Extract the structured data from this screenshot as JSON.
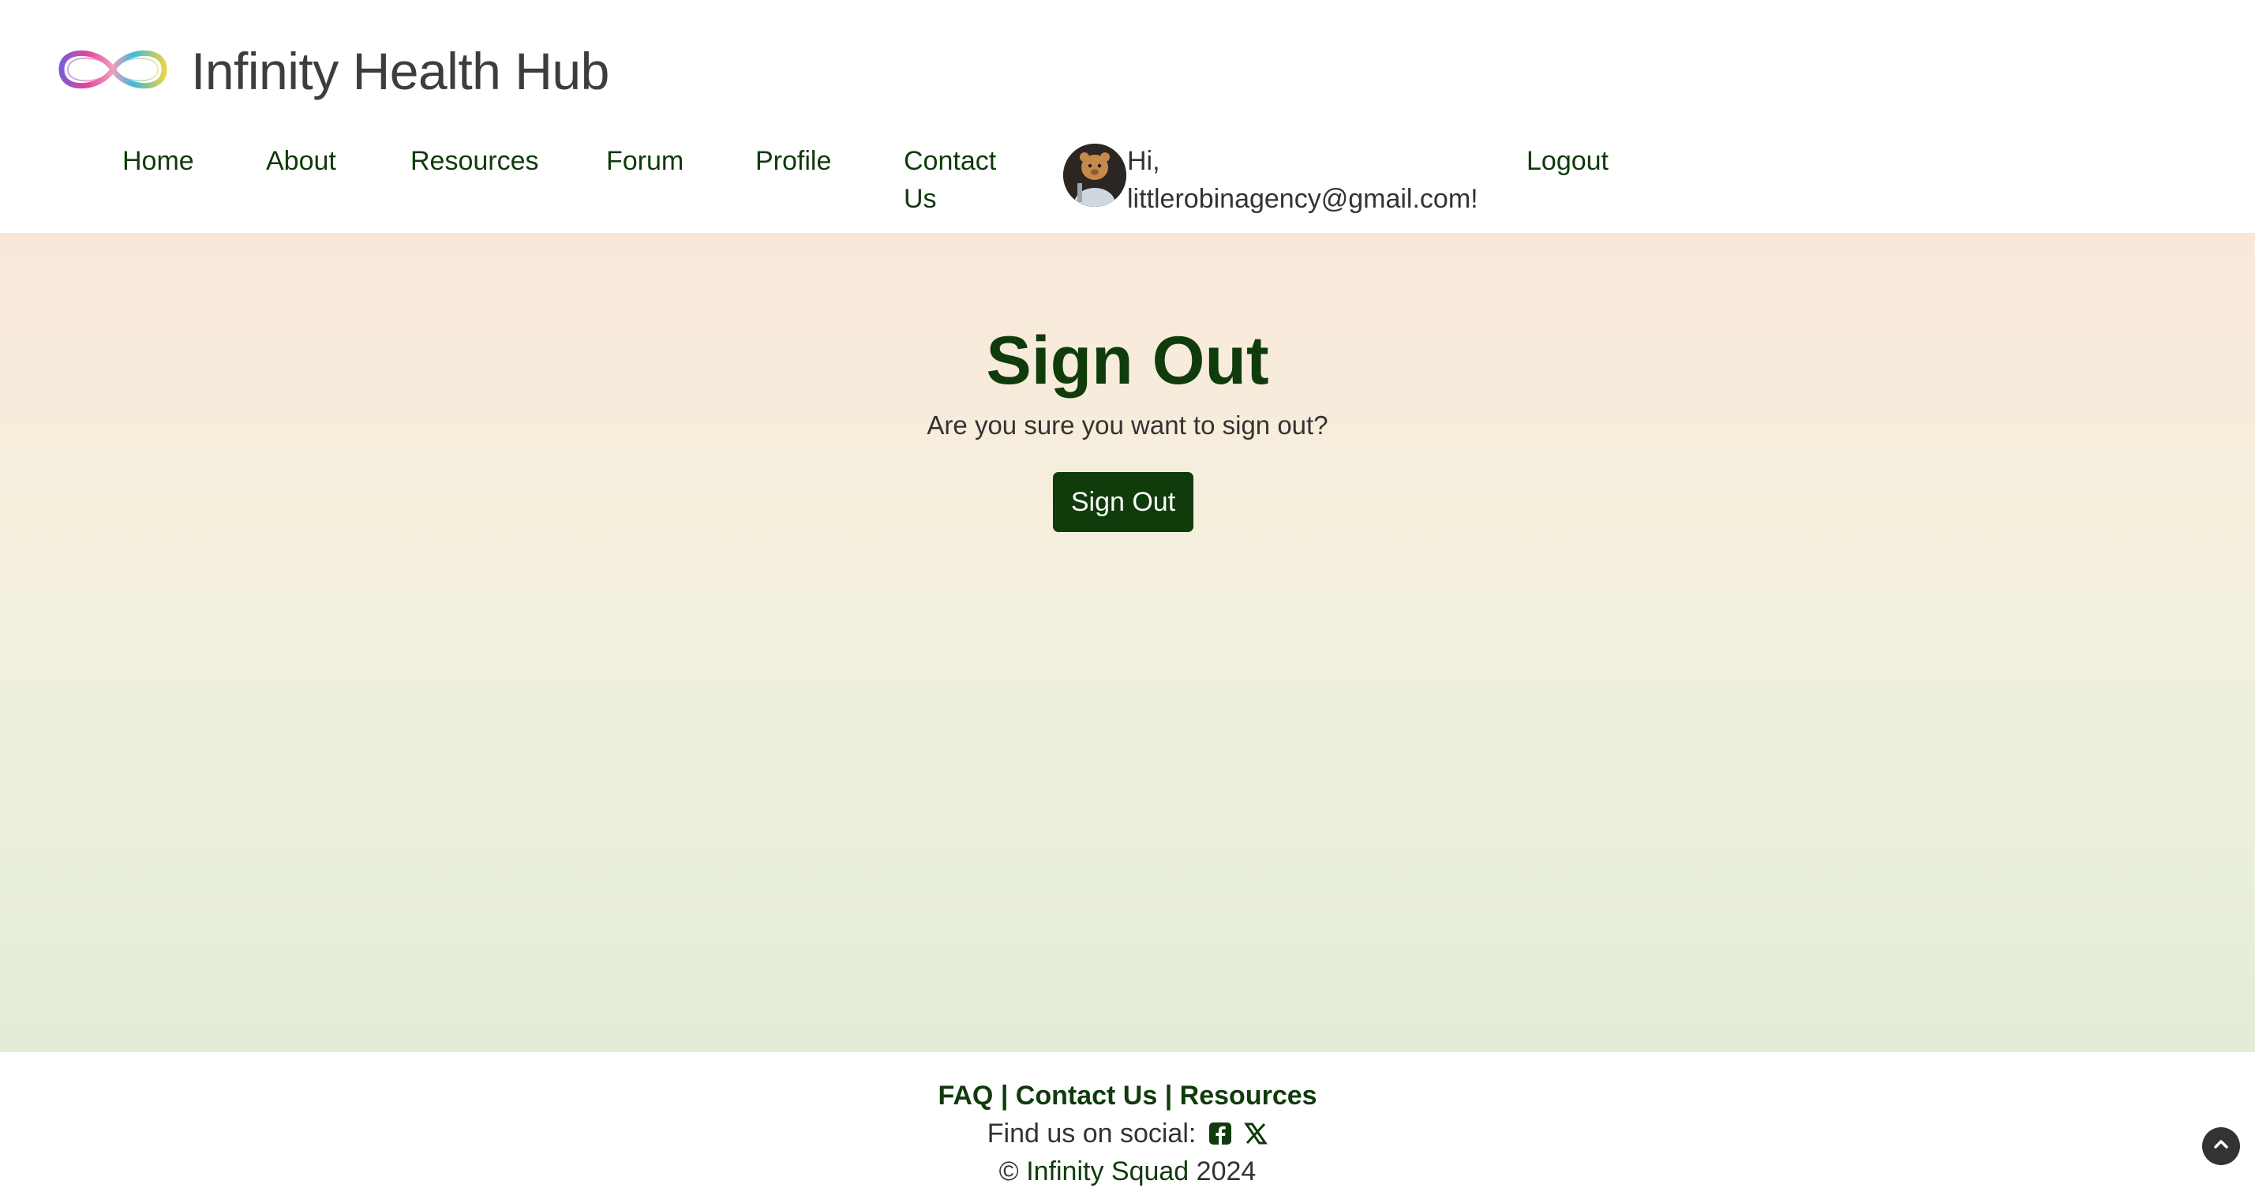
{
  "app": {
    "title": "Infinity Health Hub",
    "logo_icon": "infinity-logo-icon"
  },
  "nav": {
    "home": "Home",
    "about": "About",
    "resources": "Resources",
    "forum": "Forum",
    "profile": "Profile",
    "contact_line1": "Contact",
    "contact_line2": "Us",
    "greeting_line1": "Hi,",
    "greeting_line2": "littlerobinagency@gmail.com!",
    "logout": "Logout",
    "avatar_icon": "user-avatar"
  },
  "main": {
    "heading": "Sign Out",
    "question": "Are you sure you want to sign out?",
    "button_label": "Sign Out"
  },
  "footer": {
    "faq": "FAQ",
    "contact": "Contact Us",
    "resources": "Resources",
    "separator": "|",
    "social_label": "Find us on social:",
    "social_icons": [
      "facebook-icon",
      "x-icon"
    ],
    "copyright_symbol": "©",
    "org": "Infinity Squad",
    "year": "2024"
  },
  "colors": {
    "brand_green": "#103b0b",
    "text_gray": "#333333",
    "gradient_top": "#f9e8da",
    "gradient_bottom": "#e3ecd7"
  }
}
